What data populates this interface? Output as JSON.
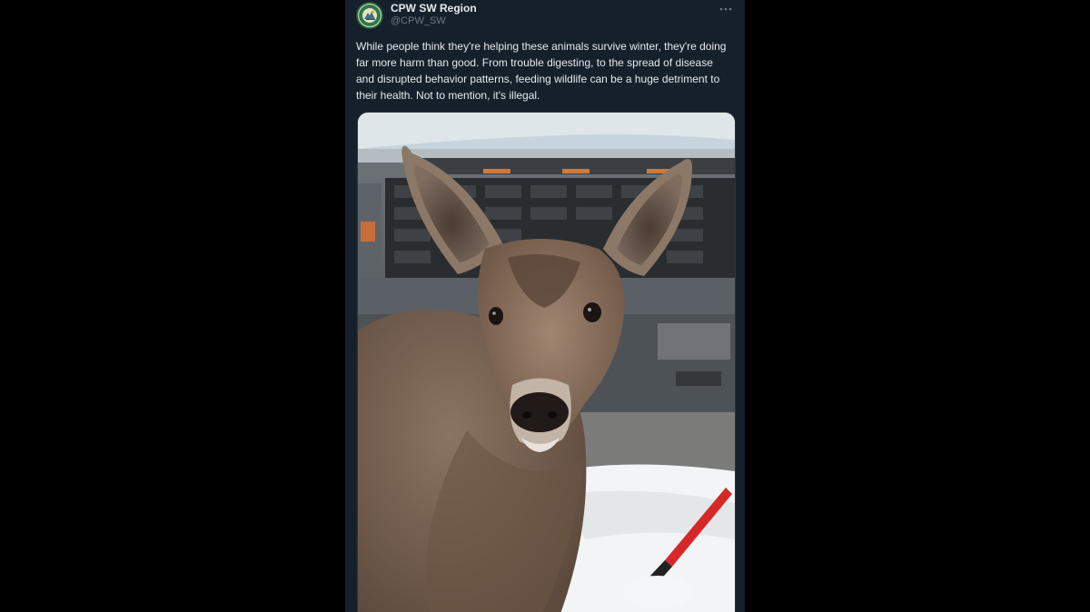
{
  "tweet": {
    "author": {
      "display_name": "CPW SW Region",
      "handle": "@CPW_SW",
      "avatar_icon": "cpw-logo-icon"
    },
    "more_icon": "more-dots-icon",
    "text": "While people think they're helping these animals survive winter, they're doing far more harm than good. From trouble digesting, to the spread of disease and disrupted behavior patterns, feeding wildlife can be a huge detriment to their health. Not to mention, it's illegal.",
    "media": {
      "subject": "deer-photo"
    }
  },
  "colors": {
    "page_background": "#000000",
    "tweet_background": "#15202b",
    "primary_text": "#e7e9ea",
    "secondary_text": "#71767b"
  }
}
